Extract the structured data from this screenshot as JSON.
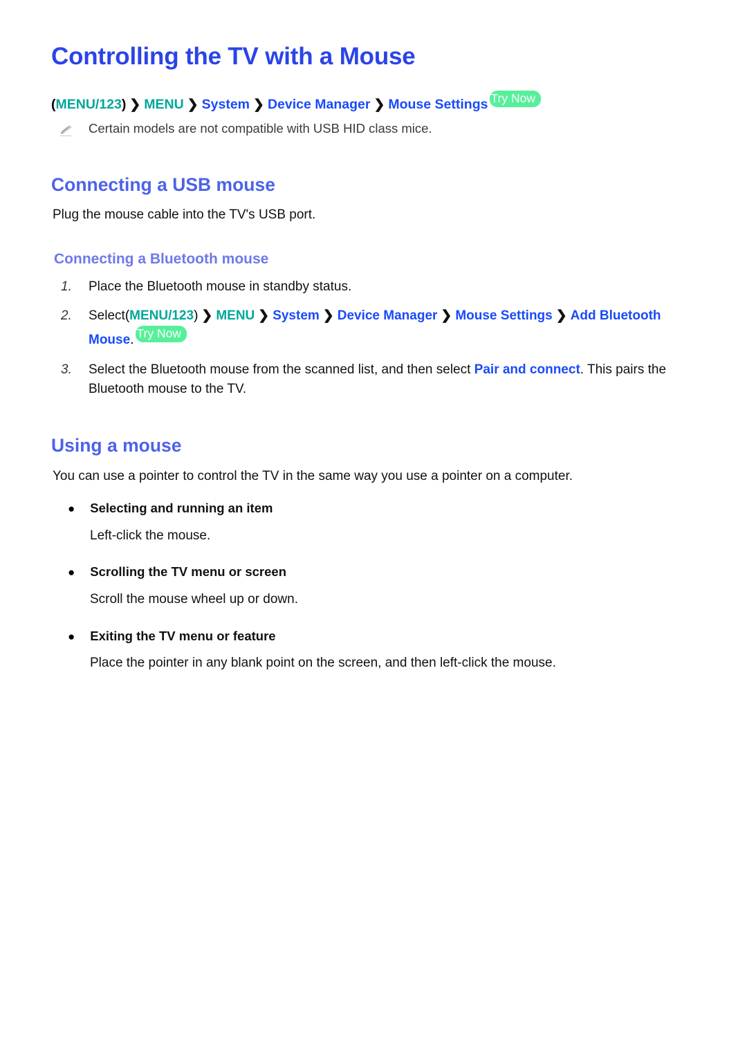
{
  "page": {
    "title": "Controlling the TV with a Mouse",
    "colors": {
      "title_blue": "#2B44E8",
      "heading_blue": "#4C63E8",
      "subheading_blue": "#6E79E8",
      "link_blue": "#1A4AFA",
      "menu_teal": "#00A79B",
      "badge_green": "#56F09A",
      "body_black": "#111111",
      "note_gray": "#3a3a3a"
    }
  },
  "breadcrumb": {
    "name": "menu-path",
    "open_paren": "(",
    "close_paren": ")",
    "separator": "›",
    "items": [
      {
        "label": "MENU/123",
        "color": "teal"
      },
      {
        "label": "MENU",
        "color": "teal"
      },
      {
        "label": "System",
        "color": "blue"
      },
      {
        "label": "Device Manager",
        "color": "blue"
      },
      {
        "label": "Mouse Settings",
        "color": "blue"
      }
    ],
    "badge": "Try Now"
  },
  "note": {
    "icon": "pencil-icon",
    "text": "Certain models are not compatible with USB HID class mice."
  },
  "sections": {
    "usb": {
      "heading": "Connecting a USB mouse",
      "paragraph": "Plug the mouse cable into the TV's USB port."
    },
    "bluetooth": {
      "heading": "Connecting a Bluetooth mouse",
      "steps": [
        {
          "number": "1.",
          "text": "Place the Bluetooth mouse in standby status."
        },
        {
          "number": "2.",
          "lead": "Select",
          "path": [
            {
              "label": "MENU/123",
              "color": "teal"
            },
            {
              "label": "MENU",
              "color": "teal"
            },
            {
              "label": "System",
              "color": "blue"
            },
            {
              "label": "Device Manager",
              "color": "blue"
            },
            {
              "label": "Mouse Settings",
              "color": "blue"
            },
            {
              "label": "Add Bluetooth Mouse",
              "color": "blue"
            }
          ],
          "trailing_period": ".",
          "badge": "Try Now"
        },
        {
          "number": "3.",
          "text_before": "Select the Bluetooth mouse from the scanned list, and then select ",
          "link": "Pair and connect",
          "text_after": ". This pairs the Bluetooth mouse to the TV."
        }
      ]
    },
    "using": {
      "heading": "Using a mouse",
      "paragraph": "You can use a pointer to control the TV in the same way you use a pointer on a computer.",
      "bullets": [
        {
          "title": "Selecting and running an item",
          "description": "Left-click the mouse."
        },
        {
          "title": "Scrolling the TV menu or screen",
          "description": "Scroll the mouse wheel up or down."
        },
        {
          "title": "Exiting the TV menu or feature",
          "description": "Place the pointer in any blank point on the screen, and then left-click the mouse."
        }
      ]
    }
  }
}
